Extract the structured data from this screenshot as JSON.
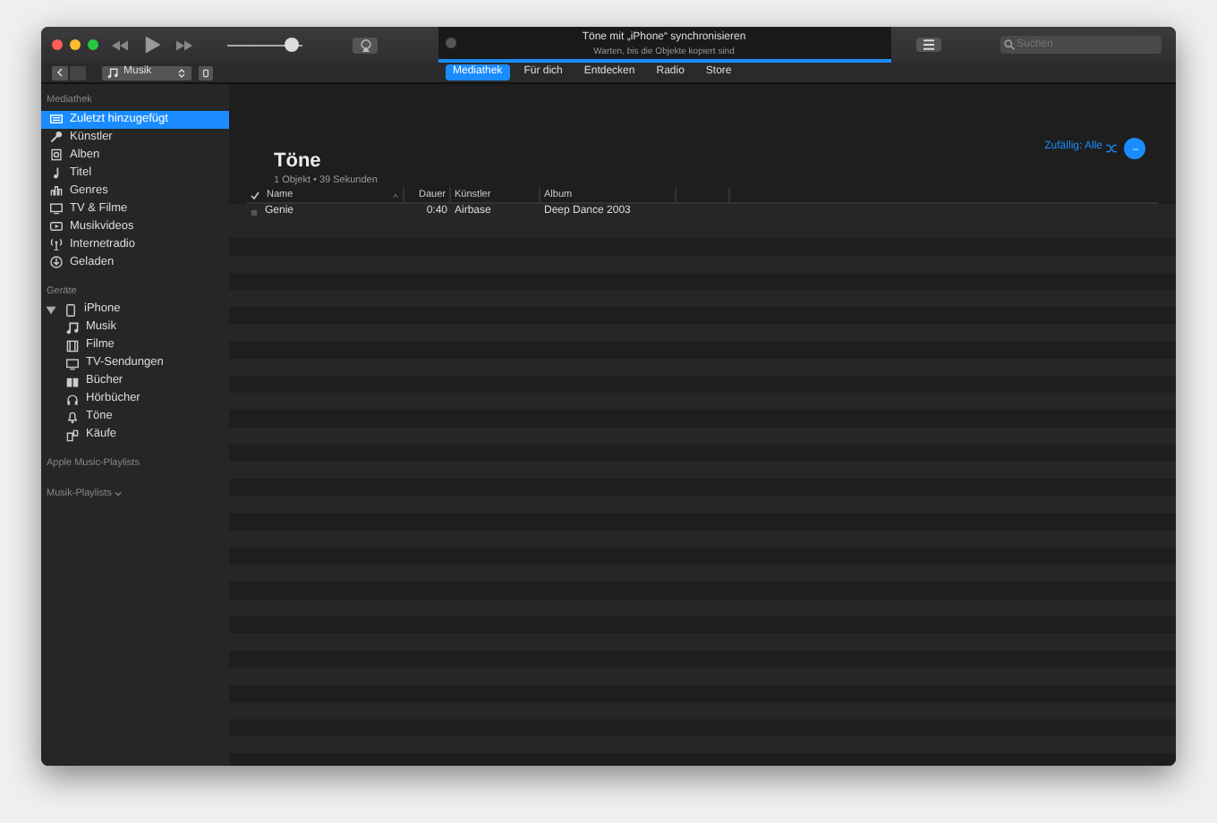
{
  "toolbar": {
    "volume": {
      "level": 0.95
    },
    "now_playing": {
      "title": "Töne mit „iPhone“ synchronisieren",
      "subtitle": "Warten, bis die Objekte kopiert sind",
      "level": 1
    },
    "search": {
      "placeholder": "Suchen"
    }
  },
  "navbar": {
    "media_picker": "Musik",
    "tabs": [
      {
        "label": "Mediathek",
        "selected": true
      },
      {
        "label": "Für dich",
        "selected": false
      },
      {
        "label": "Entdecken",
        "selected": false
      },
      {
        "label": "Radio",
        "selected": false
      },
      {
        "label": "Store",
        "selected": false
      }
    ]
  },
  "sidebar": {
    "sections": [
      {
        "title": "Mediathek",
        "items": [
          {
            "label": "Zuletzt hinzugefügt",
            "selected": true
          },
          {
            "label": "Künstler",
            "selected": false
          },
          {
            "label": "Alben",
            "selected": false
          },
          {
            "label": "Titel",
            "selected": false
          },
          {
            "label": "Genres",
            "selected": false
          },
          {
            "label": "TV & Filme",
            "selected": false
          },
          {
            "label": "Musikvideos",
            "selected": false
          },
          {
            "label": "Internetradio",
            "selected": false
          },
          {
            "label": "Geladen",
            "selected": false
          }
        ]
      },
      {
        "title": "Geräte",
        "items": [
          {
            "label": "iPhone",
            "selected": false,
            "expanded": true,
            "children": [
              {
                "label": "Musik",
                "selected": false
              },
              {
                "label": "Filme",
                "selected": false
              },
              {
                "label": "TV-Sendungen",
                "selected": false
              },
              {
                "label": "Bücher",
                "selected": false
              },
              {
                "label": "Hörbücher",
                "selected": false
              },
              {
                "label": "Töne",
                "selected": false
              },
              {
                "label": "Käufe",
                "selected": false
              }
            ]
          }
        ]
      },
      {
        "title": "Apple Music-Playlists"
      },
      {
        "title": "Musik-Playlists",
        "collapsible": true
      }
    ]
  },
  "content": {
    "title": "Töne",
    "summary": "1 Objekt • 39 Sekunden",
    "shuffle": "Zufällig: Alle",
    "table": {
      "columns": [
        {
          "label": "Name",
          "sorted": true
        },
        {
          "label": "Dauer",
          "sorted": false
        },
        {
          "label": "Künstler",
          "sorted": false
        },
        {
          "label": "Album",
          "sorted": false
        }
      ],
      "rows": [
        {
          "name": "Genie",
          "duration": "0:40",
          "artist": "Airbase",
          "album": "Deep Dance 2003"
        }
      ]
    }
  }
}
